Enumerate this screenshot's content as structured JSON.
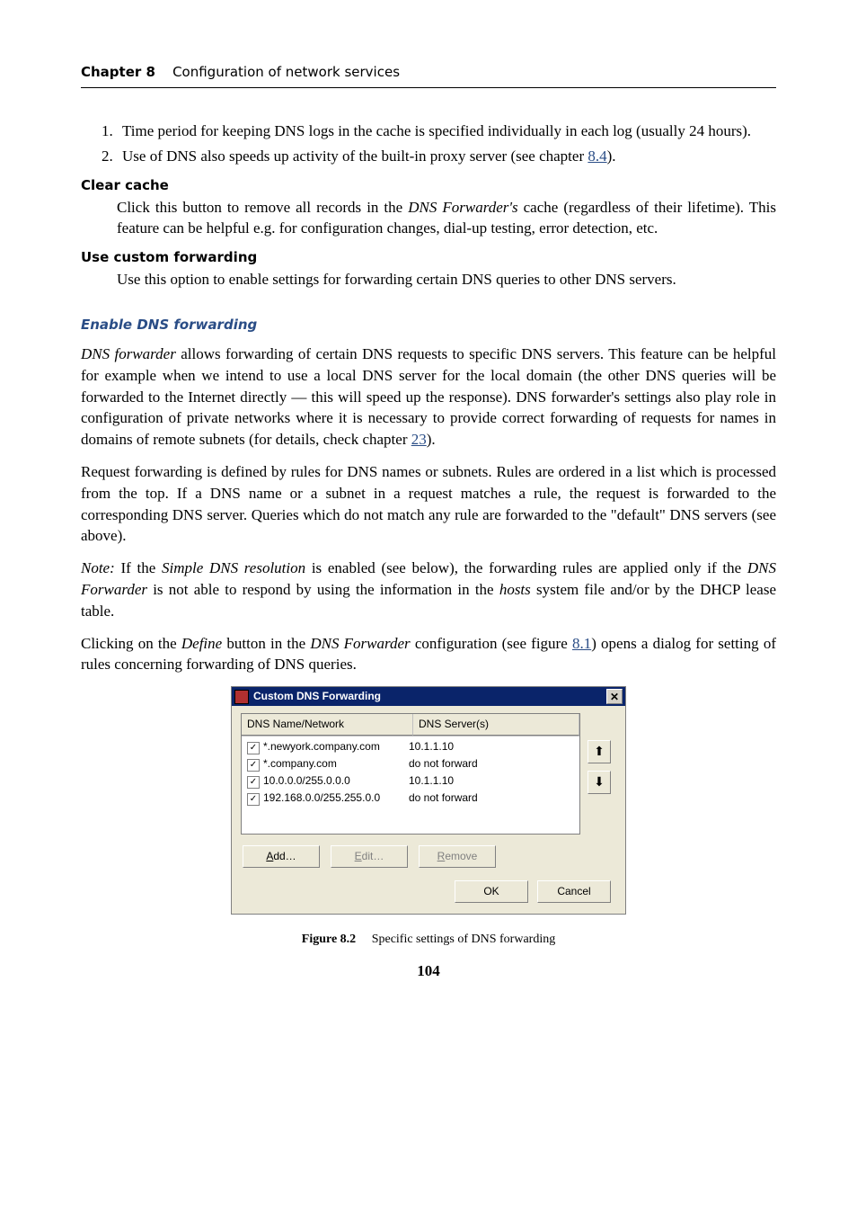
{
  "header": {
    "chapter": "Chapter 8",
    "title": "Configuration of network services"
  },
  "list": {
    "i1": "Time period for keeping DNS logs in the cache is specified individually in each log (usually 24 hours).",
    "i2_a": "Use of DNS also speeds up activity of the built-in proxy server (see chapter ",
    "i2_link": "8.4",
    "i2_b": ")."
  },
  "clear": {
    "term": "Clear cache",
    "body_a": "Click this button to remove all records in the ",
    "body_em": "DNS Forwarder's",
    "body_b": " cache (regardless of their lifetime). This feature can be helpful e.g. for configuration changes, dial-up testing, error detection, etc."
  },
  "custom": {
    "term": "Use custom forwarding",
    "body": "Use this option to enable settings for forwarding certain DNS queries to other DNS servers."
  },
  "subhead": "Enable DNS forwarding",
  "p1": {
    "a": "DNS forwarder",
    "b": " allows forwarding of certain DNS requests to specific DNS servers. This feature can be helpful for example when we intend to use a local DNS server for the local domain (the other DNS queries will be forwarded to the Internet directly — this will speed up the response). DNS forwarder's settings also play role in configuration of private networks where it is necessary to provide correct forwarding of requests for names in domains of remote subnets (for details, check chapter ",
    "link": "23",
    "c": ")."
  },
  "p2": "Request forwarding is defined by rules for DNS names or subnets. Rules are ordered in a list which is processed from the top. If a DNS name or a subnet in a request matches a rule, the request is forwarded to the corresponding DNS server. Queries which do not match any rule are forwarded to the \"default\" DNS servers (see above).",
  "p3": {
    "a": "Note:",
    "b": " If the ",
    "c": "Simple DNS resolution",
    "d": " is enabled (see below), the forwarding rules are applied only if the ",
    "e": "DNS Forwarder",
    "f": " is not able to respond by using the information in the ",
    "g": "hosts",
    "h": " system file and/or by the DHCP lease table."
  },
  "p4": {
    "a": "Clicking on the ",
    "b": "Define",
    "c": " button in the ",
    "d": "DNS Forwarder",
    "e": " configuration (see figure ",
    "link": "8.1",
    "f": ") opens a dialog for setting of rules concerning forwarding of DNS queries."
  },
  "dialog": {
    "title": "Custom DNS Forwarding",
    "col_name": "DNS Name/Network",
    "col_srv": "DNS Server(s)",
    "rows": [
      {
        "name": "*.newyork.company.com",
        "server": "10.1.1.10"
      },
      {
        "name": "*.company.com",
        "server": "do not forward"
      },
      {
        "name": "10.0.0.0/255.0.0.0",
        "server": "10.1.1.10"
      },
      {
        "name": "192.168.0.0/255.255.0.0",
        "server": "do not forward"
      }
    ],
    "btn_add_u": "A",
    "btn_add": "dd…",
    "btn_edit_u": "E",
    "btn_edit": "dit…",
    "btn_remove_u": "R",
    "btn_remove": "emove",
    "ok": "OK",
    "cancel": "Cancel",
    "arrow_up": "⬆",
    "arrow_down": "⬇"
  },
  "caption": {
    "label": "Figure 8.2",
    "text": "Specific settings of DNS forwarding"
  },
  "page": "104"
}
